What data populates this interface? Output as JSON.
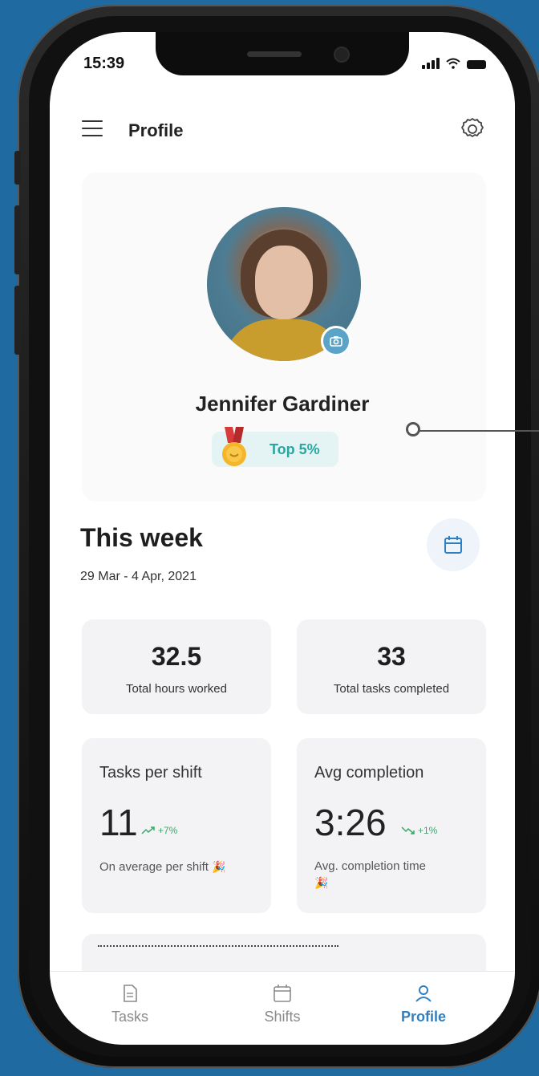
{
  "status_bar": {
    "time": "15:39"
  },
  "header": {
    "title": "Profile"
  },
  "profile": {
    "name": "Jennifer Gardiner",
    "rank": "Top 5%"
  },
  "week": {
    "title": "This week",
    "range": "29 Mar - 4 Apr, 2021"
  },
  "stats": [
    {
      "value": "32.5",
      "label": "Total hours worked"
    },
    {
      "value": "33",
      "label": "Total tasks completed"
    }
  ],
  "metrics": [
    {
      "title": "Tasks per shift",
      "value": "11",
      "trend": "+7%",
      "description": "On average per shift"
    },
    {
      "title": "Avg completion",
      "value": "3:26",
      "trend": "+1%",
      "description": "Avg. completion time"
    }
  ],
  "tabs": [
    {
      "label": "Tasks",
      "icon": "document-icon"
    },
    {
      "label": "Shifts",
      "icon": "calendar-icon"
    },
    {
      "label": "Profile",
      "icon": "user-icon"
    }
  ],
  "colors": {
    "background": "#1f6aa0",
    "accent": "#2f7fc1",
    "badge_text": "#2aa6a0",
    "trend_up": "#3aa86a"
  }
}
